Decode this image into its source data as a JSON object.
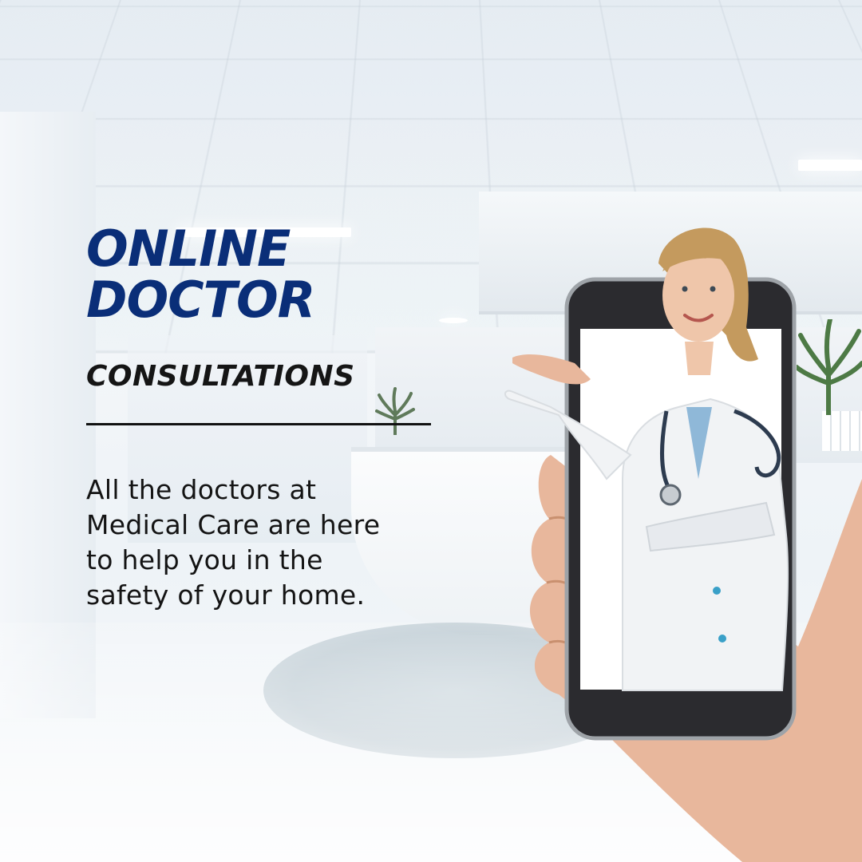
{
  "headline": {
    "line1": "ONLINE",
    "line2": "DOCTOR",
    "subtitle": "CONSULTATIONS"
  },
  "body": {
    "line1": "All the doctors at",
    "line2": "Medical Care are here",
    "line3": "to help you in the",
    "line4": "safety of your home."
  },
  "colors": {
    "headline_blue": "#0a2e78",
    "text_black": "#141414",
    "background": "#eef3f7"
  }
}
